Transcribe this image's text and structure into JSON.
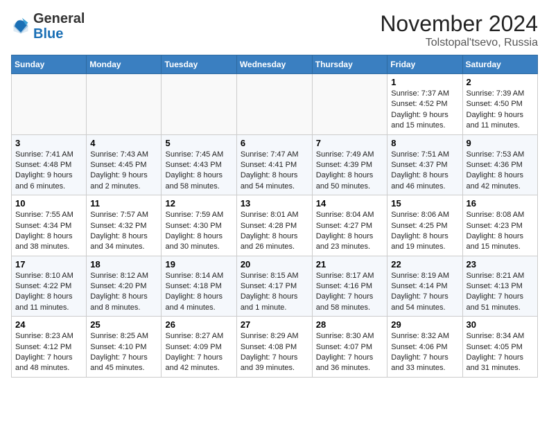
{
  "header": {
    "logo_general": "General",
    "logo_blue": "Blue",
    "month_title": "November 2024",
    "location": "Tolstopal'tsevo, Russia"
  },
  "days_of_week": [
    "Sunday",
    "Monday",
    "Tuesday",
    "Wednesday",
    "Thursday",
    "Friday",
    "Saturday"
  ],
  "weeks": [
    [
      {
        "day": "",
        "detail": ""
      },
      {
        "day": "",
        "detail": ""
      },
      {
        "day": "",
        "detail": ""
      },
      {
        "day": "",
        "detail": ""
      },
      {
        "day": "",
        "detail": ""
      },
      {
        "day": "1",
        "detail": "Sunrise: 7:37 AM\nSunset: 4:52 PM\nDaylight: 9 hours and 15 minutes."
      },
      {
        "day": "2",
        "detail": "Sunrise: 7:39 AM\nSunset: 4:50 PM\nDaylight: 9 hours and 11 minutes."
      }
    ],
    [
      {
        "day": "3",
        "detail": "Sunrise: 7:41 AM\nSunset: 4:48 PM\nDaylight: 9 hours and 6 minutes."
      },
      {
        "day": "4",
        "detail": "Sunrise: 7:43 AM\nSunset: 4:45 PM\nDaylight: 9 hours and 2 minutes."
      },
      {
        "day": "5",
        "detail": "Sunrise: 7:45 AM\nSunset: 4:43 PM\nDaylight: 8 hours and 58 minutes."
      },
      {
        "day": "6",
        "detail": "Sunrise: 7:47 AM\nSunset: 4:41 PM\nDaylight: 8 hours and 54 minutes."
      },
      {
        "day": "7",
        "detail": "Sunrise: 7:49 AM\nSunset: 4:39 PM\nDaylight: 8 hours and 50 minutes."
      },
      {
        "day": "8",
        "detail": "Sunrise: 7:51 AM\nSunset: 4:37 PM\nDaylight: 8 hours and 46 minutes."
      },
      {
        "day": "9",
        "detail": "Sunrise: 7:53 AM\nSunset: 4:36 PM\nDaylight: 8 hours and 42 minutes."
      }
    ],
    [
      {
        "day": "10",
        "detail": "Sunrise: 7:55 AM\nSunset: 4:34 PM\nDaylight: 8 hours and 38 minutes."
      },
      {
        "day": "11",
        "detail": "Sunrise: 7:57 AM\nSunset: 4:32 PM\nDaylight: 8 hours and 34 minutes."
      },
      {
        "day": "12",
        "detail": "Sunrise: 7:59 AM\nSunset: 4:30 PM\nDaylight: 8 hours and 30 minutes."
      },
      {
        "day": "13",
        "detail": "Sunrise: 8:01 AM\nSunset: 4:28 PM\nDaylight: 8 hours and 26 minutes."
      },
      {
        "day": "14",
        "detail": "Sunrise: 8:04 AM\nSunset: 4:27 PM\nDaylight: 8 hours and 23 minutes."
      },
      {
        "day": "15",
        "detail": "Sunrise: 8:06 AM\nSunset: 4:25 PM\nDaylight: 8 hours and 19 minutes."
      },
      {
        "day": "16",
        "detail": "Sunrise: 8:08 AM\nSunset: 4:23 PM\nDaylight: 8 hours and 15 minutes."
      }
    ],
    [
      {
        "day": "17",
        "detail": "Sunrise: 8:10 AM\nSunset: 4:22 PM\nDaylight: 8 hours and 11 minutes."
      },
      {
        "day": "18",
        "detail": "Sunrise: 8:12 AM\nSunset: 4:20 PM\nDaylight: 8 hours and 8 minutes."
      },
      {
        "day": "19",
        "detail": "Sunrise: 8:14 AM\nSunset: 4:18 PM\nDaylight: 8 hours and 4 minutes."
      },
      {
        "day": "20",
        "detail": "Sunrise: 8:15 AM\nSunset: 4:17 PM\nDaylight: 8 hours and 1 minute."
      },
      {
        "day": "21",
        "detail": "Sunrise: 8:17 AM\nSunset: 4:16 PM\nDaylight: 7 hours and 58 minutes."
      },
      {
        "day": "22",
        "detail": "Sunrise: 8:19 AM\nSunset: 4:14 PM\nDaylight: 7 hours and 54 minutes."
      },
      {
        "day": "23",
        "detail": "Sunrise: 8:21 AM\nSunset: 4:13 PM\nDaylight: 7 hours and 51 minutes."
      }
    ],
    [
      {
        "day": "24",
        "detail": "Sunrise: 8:23 AM\nSunset: 4:12 PM\nDaylight: 7 hours and 48 minutes."
      },
      {
        "day": "25",
        "detail": "Sunrise: 8:25 AM\nSunset: 4:10 PM\nDaylight: 7 hours and 45 minutes."
      },
      {
        "day": "26",
        "detail": "Sunrise: 8:27 AM\nSunset: 4:09 PM\nDaylight: 7 hours and 42 minutes."
      },
      {
        "day": "27",
        "detail": "Sunrise: 8:29 AM\nSunset: 4:08 PM\nDaylight: 7 hours and 39 minutes."
      },
      {
        "day": "28",
        "detail": "Sunrise: 8:30 AM\nSunset: 4:07 PM\nDaylight: 7 hours and 36 minutes."
      },
      {
        "day": "29",
        "detail": "Sunrise: 8:32 AM\nSunset: 4:06 PM\nDaylight: 7 hours and 33 minutes."
      },
      {
        "day": "30",
        "detail": "Sunrise: 8:34 AM\nSunset: 4:05 PM\nDaylight: 7 hours and 31 minutes."
      }
    ]
  ]
}
